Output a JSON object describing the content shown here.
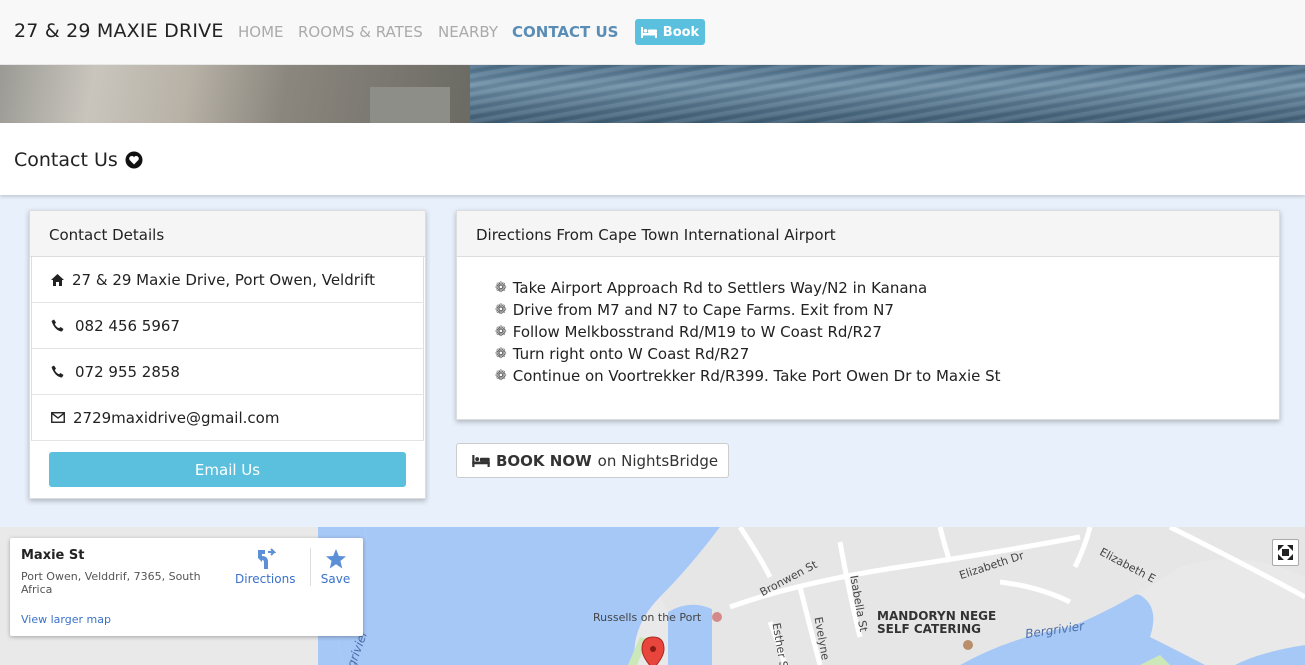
{
  "nav": {
    "brand": "27 & 29 MAXIE DRIVE",
    "links": [
      "HOME",
      "ROOMS & RATES",
      "NEARBY",
      "CONTACT US"
    ],
    "book_label": "Book"
  },
  "page": {
    "title": "Contact Us"
  },
  "contact": {
    "heading": "Contact Details",
    "address": "27 & 29 Maxie Drive, Port Owen, Veldrift",
    "phone1": "082 456 5967",
    "phone2": "072 955 2858",
    "email": "2729maxidrive@gmail.com",
    "email_button": "Email Us"
  },
  "directions": {
    "heading": "Directions From Cape Town International Airport",
    "steps": [
      "Take Airport Approach Rd to Settlers Way/N2 in Kanana",
      "Drive from M7 and N7 to Cape Farms. Exit from N7",
      "Follow Melkbosstrand Rd/M19 to W Coast Rd/R27",
      "Turn right onto W Coast Rd/R27",
      "Continue on Voortrekker Rd/R399. Take Port Owen Dr to Maxie St"
    ]
  },
  "booking": {
    "bold": "BOOK NOW",
    "rest": "on NightsBridge"
  },
  "map": {
    "place_name": "Maxie St",
    "place_address": "Port Owen, Velddrif, 7365, South Africa",
    "larger_map": "View larger map",
    "directions": "Directions",
    "save": "Save",
    "labels": {
      "russells": "Russells on the Port",
      "mandoryn1": "MANDORYN NEGE",
      "mandoryn2": "SELF CATERING",
      "bergrivier": "Bergrivier",
      "bronwen": "Bronwen St",
      "elizabeth_dr": "Elizabeth Dr",
      "elizabeth_e": "Elizabeth E",
      "isabella": "Isabella St",
      "evelyne": "Evelyne",
      "esther": "Esther S",
      "grivier": "grivier"
    }
  },
  "colors": {
    "accent": "#5bc0de",
    "active_nav": "#5a8db5",
    "page_bg": "#e8f0fc",
    "water": "#a8c8f8"
  }
}
